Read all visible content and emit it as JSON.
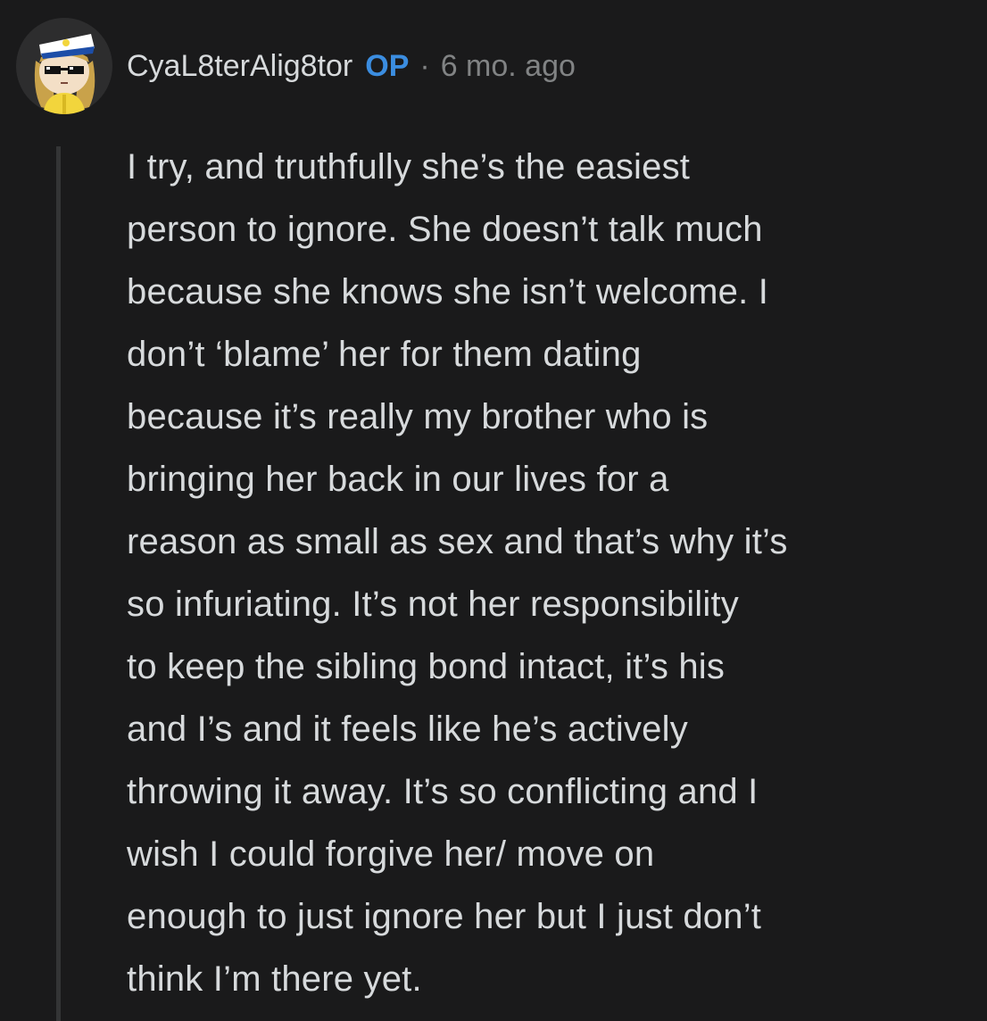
{
  "comment": {
    "author": "CyaL8terAlig8tor",
    "badge": "OP",
    "separator": "·",
    "timestamp": "6 mo. ago",
    "avatar_icon": "snoo-avatar-sailor-cap",
    "body_lines": [
      "I try, and truthfully she’s the easiest",
      "person to ignore. She doesn’t talk much",
      "because she knows she isn’t welcome. I",
      "don’t ‘blame’ her for them dating",
      "because it’s really my brother who is",
      "bringing her back in our lives for a",
      "reason as small as sex and that’s why it’s",
      "so infuriating. It’s not her responsibility",
      "to keep the sibling bond intact, it’s his",
      "and I’s and it feels like he’s actively",
      "throwing it away. It’s so conflicting and I",
      "wish I could forgive her/ move on",
      "enough to just ignore her but I just don’t",
      "think I’m there yet."
    ]
  },
  "colors": {
    "background": "#1a1a1b",
    "text": "#d7dadc",
    "op_badge": "#3b8de0",
    "meta": "#818384",
    "thread_line": "#343536"
  }
}
